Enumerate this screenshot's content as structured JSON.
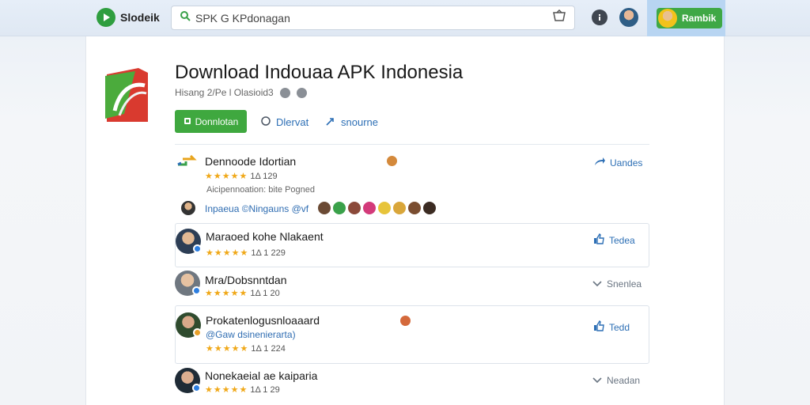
{
  "header": {
    "brand": "Slodeik",
    "search_value": "SPK G KPdonagan",
    "user_label": "Rambik"
  },
  "app": {
    "title": "Download Indouaa APK Indonesia",
    "meta": "Hisang 2/Pe l Olasioid3",
    "download_label": "Donnlotan",
    "action1_label": "Dlervat",
    "action2_label": "snourne"
  },
  "reviews": [
    {
      "name": "Dennoode Idortian",
      "rating_text": "1Δ 129",
      "note": "Aicipennoation: bite Pogned",
      "tags": "Inpaeua  ©Ningauns  @vf",
      "action": "Uandes"
    },
    {
      "name": "Maraoed kohe Nlakaent",
      "rating_text": "1Δ 1 229",
      "action": "Tedea"
    },
    {
      "name": "Mra/Dobsnntdan",
      "rating_text": "1Δ 1 20",
      "action": "Snenlea"
    },
    {
      "name": "Prokatenlogusnloaaard",
      "sub": "@Gaw dsinenierarta)",
      "rating_text": "1Δ 1 224",
      "action": "Tedd"
    },
    {
      "name": "Nonekaeial ae kaiparia",
      "rating_text": "1Δ 1 29",
      "action": "Neadan"
    }
  ],
  "colors": {
    "accent_green": "#3fa83f",
    "link_blue": "#2d6fb5",
    "star": "#f0a818"
  }
}
